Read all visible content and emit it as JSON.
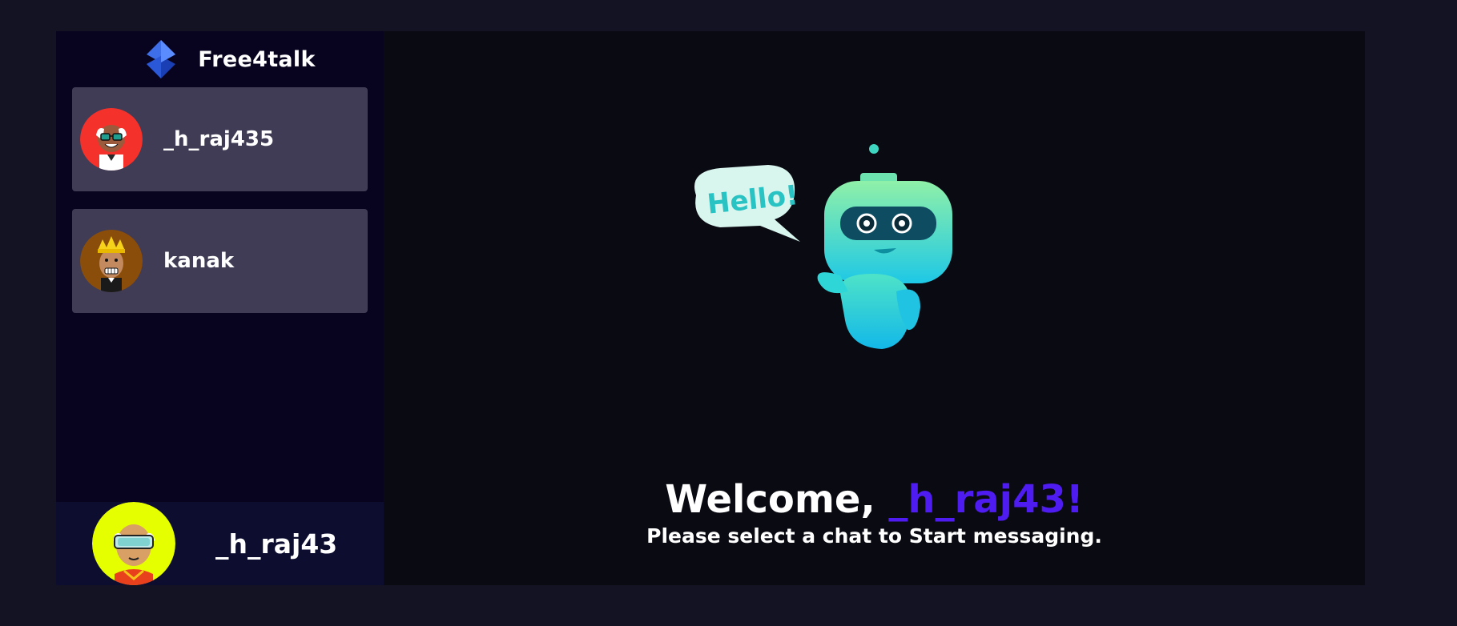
{
  "brand": {
    "name": "Free4talk",
    "logo_icon": "diamond-logo-icon"
  },
  "contacts": [
    {
      "name": "_h_raj435",
      "avatar": "avatar-old-man-sunglasses",
      "avatar_bg": "#f5312b"
    },
    {
      "name": "kanak",
      "avatar": "avatar-king-crown",
      "avatar_bg": "#8a4d0a"
    }
  ],
  "current_user": {
    "name": "_h_raj43",
    "avatar": "avatar-vr-goggles",
    "avatar_bg": "#e5ff00"
  },
  "welcome": {
    "prefix": "Welcome, ",
    "username": "_h_raj43!",
    "subtitle": "Please select a chat to Start messaging."
  },
  "illustration": {
    "speech_bubble_text": "Hello!",
    "icon": "robot-hello-illustration"
  },
  "colors": {
    "background": "#131324",
    "sidebar": "#080420",
    "contact_card": "#403c55",
    "current_user_bar": "#0d0d30",
    "chat_area": "#0a0a12",
    "accent": "#4e1cf0"
  }
}
